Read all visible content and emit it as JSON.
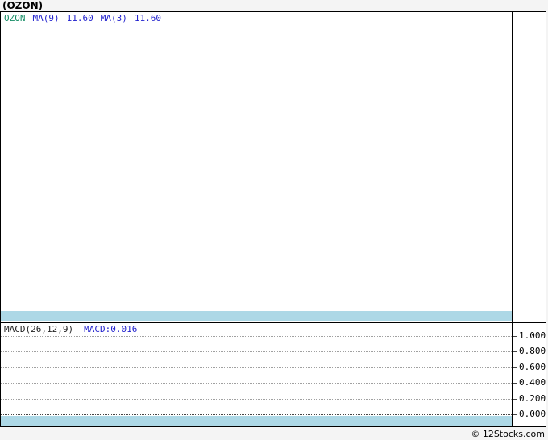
{
  "header": {
    "title": "(OZON)"
  },
  "main_chart": {
    "legend": {
      "ticker": "OZON",
      "ma9_label": "MA(9)",
      "ma9_value": "11.60",
      "ma3_label": "MA(3)",
      "ma3_value": "11.60"
    }
  },
  "macd_panel": {
    "label": "MACD(26,12,9)",
    "value": "MACD:0.016",
    "axis_ticks": [
      "1.000",
      "0.800",
      "0.600",
      "0.400",
      "0.200",
      "0.000"
    ]
  },
  "footer": {
    "credit": "© 12Stocks.com"
  },
  "colors": {
    "ticker_green": "#148C64",
    "indicator_blue": "#2323CE",
    "band_blue": "#ADD8E6",
    "border_black": "#000000",
    "page_gray": "#F4F4F4",
    "grid_gray": "#A0A0A0"
  },
  "chart_data": {
    "type": "line",
    "title": "(OZON)",
    "panels": [
      {
        "name": "price",
        "ticker": "OZON",
        "series": [
          {
            "name": "MA(9)",
            "current_value": 11.6
          },
          {
            "name": "MA(3)",
            "current_value": 11.6
          }
        ],
        "plotted_points_visible": false
      },
      {
        "name": "MACD",
        "params": [
          26,
          12,
          9
        ],
        "current_value": 0.016,
        "ylim": [
          0.0,
          1.0
        ],
        "yticks": [
          1.0,
          0.8,
          0.6,
          0.4,
          0.2,
          0.0
        ],
        "grid": true,
        "plotted_points_visible": false
      }
    ],
    "legend_position": "top-left",
    "source": "© 12Stocks.com"
  }
}
